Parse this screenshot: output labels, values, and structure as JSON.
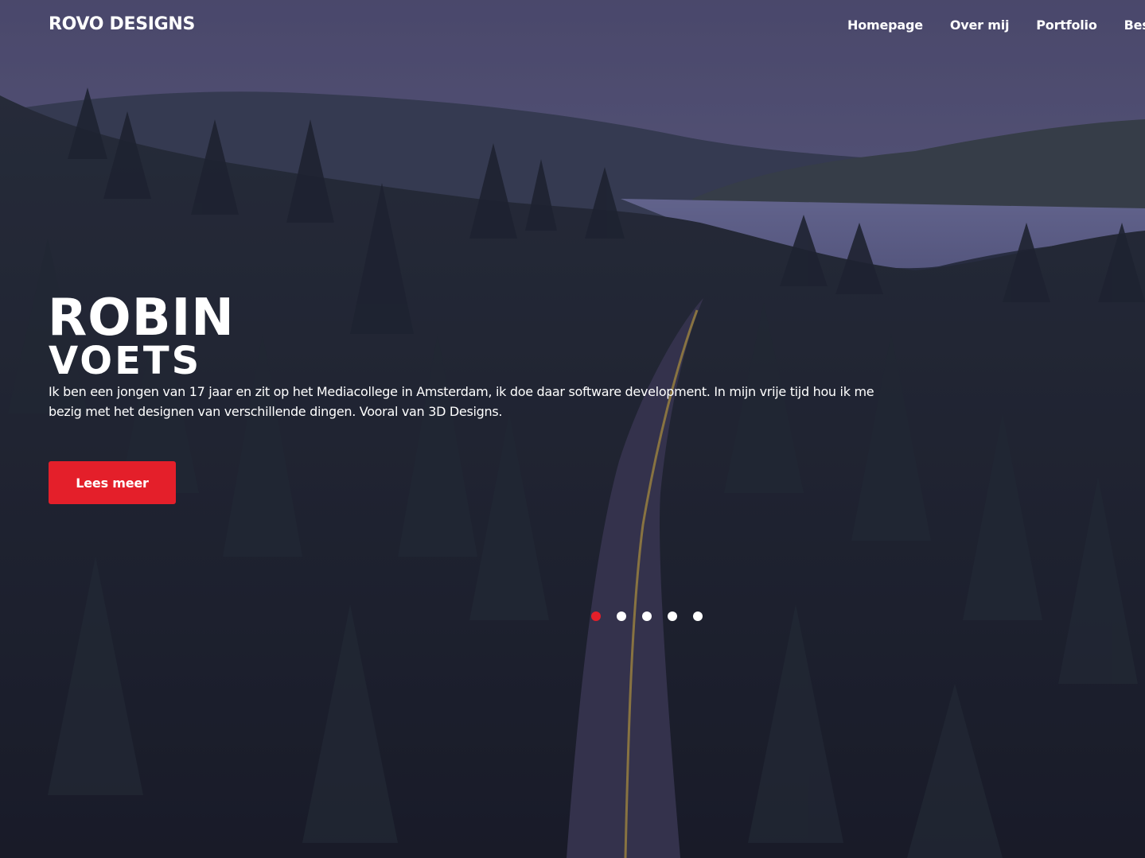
{
  "brand": {
    "logo_text": "ROVO DESIGNS"
  },
  "nav": {
    "items": [
      {
        "label": "Homepage"
      },
      {
        "label": "Over mij"
      },
      {
        "label": "Portfolio"
      },
      {
        "label": "Bestel"
      }
    ]
  },
  "hero": {
    "first_name": "ROBIN",
    "last_name": "VOETS",
    "intro": "Ik ben een jongen van 17 jaar en zit op het Mediacollege in Amsterdam, ik doe daar software development. In mijn vrije tijd hou ik me bezig met het designen van verschillende dingen. Vooral van 3D Designs.",
    "cta_label": "Lees meer"
  },
  "slider": {
    "slide_count": 5,
    "active_index": 0
  },
  "colors": {
    "accent": "#e41f2a",
    "text": "#ffffff",
    "overlay": "#2a2650"
  }
}
